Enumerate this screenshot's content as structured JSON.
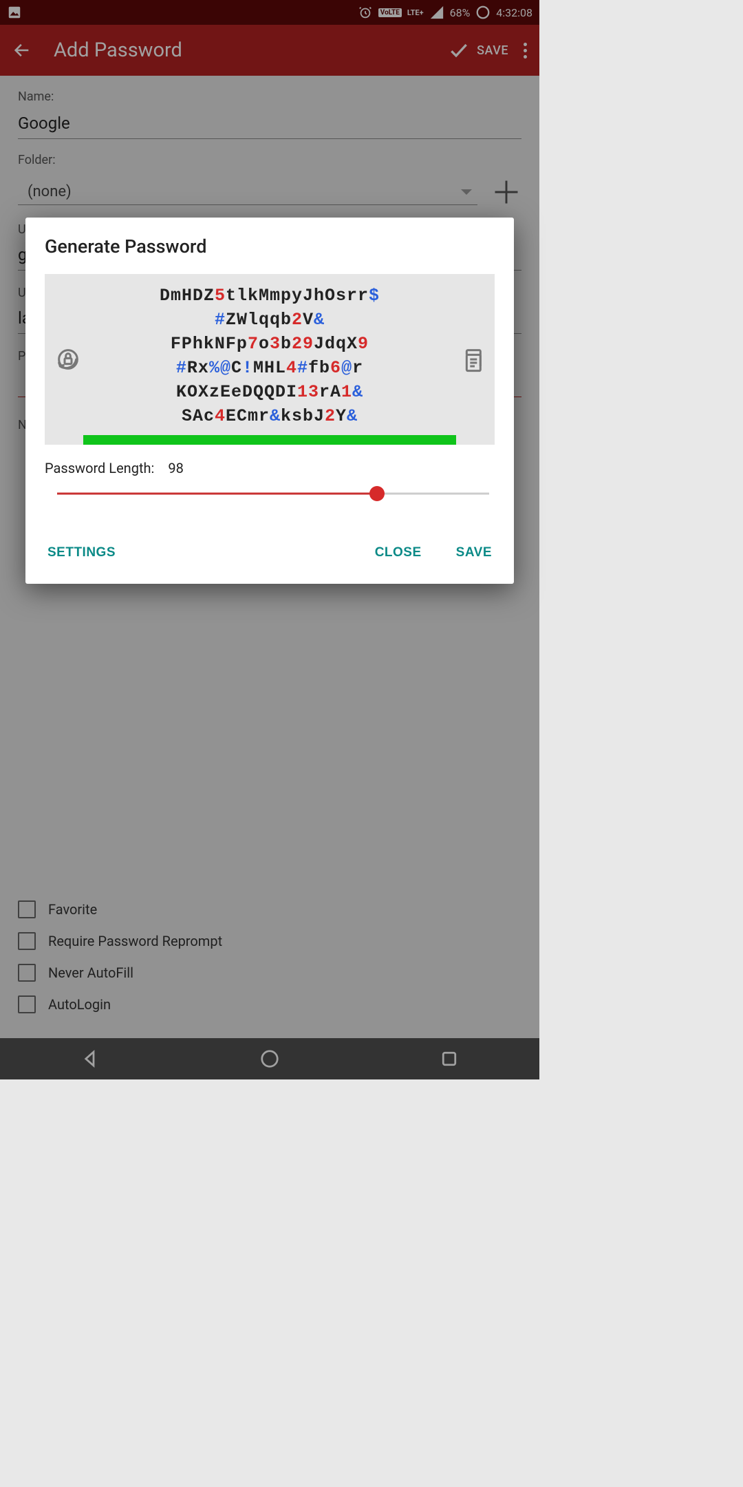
{
  "status_bar": {
    "volte_label": "VoLTE",
    "lte_label": "LTE+",
    "battery_percent": "68%",
    "time": "4:32:08"
  },
  "app_bar": {
    "title": "Add Password",
    "save_label": "SAVE"
  },
  "form": {
    "name_label": "Name:",
    "name_value": "Google",
    "folder_label": "Folder:",
    "folder_value": "(none)",
    "url_label_partial": "UR",
    "url_value_partial": "g",
    "username_label_partial": "Us",
    "username_value_partial": "la",
    "password_label_partial": "Pa",
    "notes_label_partial": "No"
  },
  "checkboxes": {
    "favorite": "Favorite",
    "reprompt": "Require Password Reprompt",
    "never_autofill": "Never AutoFill",
    "autologin": "AutoLogin"
  },
  "dialog": {
    "title": "Generate Password",
    "password_segments": [
      {
        "t": "DmHDZ",
        "c": ""
      },
      {
        "t": "5",
        "c": "red"
      },
      {
        "t": "tlkMmpyJhOsrr",
        "c": ""
      },
      {
        "t": "$",
        "c": "blue"
      },
      {
        "t": " ",
        "br": true
      },
      {
        "t": "#",
        "c": "blue"
      },
      {
        "t": "ZWlqqb",
        "c": ""
      },
      {
        "t": "2",
        "c": "red"
      },
      {
        "t": "V",
        "c": ""
      },
      {
        "t": "&",
        "c": "blue"
      },
      {
        "t": " ",
        "br": true
      },
      {
        "t": "FPhkNFp",
        "c": ""
      },
      {
        "t": "7",
        "c": "red"
      },
      {
        "t": "o",
        "c": ""
      },
      {
        "t": "3",
        "c": "red"
      },
      {
        "t": "b",
        "c": ""
      },
      {
        "t": "29",
        "c": "red"
      },
      {
        "t": "JdqX",
        "c": ""
      },
      {
        "t": "9",
        "c": "red"
      },
      {
        "t": " ",
        "br": true
      },
      {
        "t": "#",
        "c": "blue"
      },
      {
        "t": "Rx",
        "c": ""
      },
      {
        "t": "%@",
        "c": "blue"
      },
      {
        "t": "C",
        "c": ""
      },
      {
        "t": "!",
        "c": "blue"
      },
      {
        "t": "MHL",
        "c": ""
      },
      {
        "t": "4",
        "c": "red"
      },
      {
        "t": "#",
        "c": "blue"
      },
      {
        "t": "fb",
        "c": ""
      },
      {
        "t": "6",
        "c": "red"
      },
      {
        "t": "@",
        "c": "blue"
      },
      {
        "t": "r",
        "c": ""
      },
      {
        "t": " ",
        "br": true
      },
      {
        "t": "KOXzEeDQQDI",
        "c": ""
      },
      {
        "t": "13",
        "c": "red"
      },
      {
        "t": "rA",
        "c": ""
      },
      {
        "t": "1",
        "c": "red"
      },
      {
        "t": "&",
        "c": "blue"
      },
      {
        "t": " ",
        "br": true
      },
      {
        "t": "SAc",
        "c": ""
      },
      {
        "t": "4",
        "c": "red"
      },
      {
        "t": "ECmr",
        "c": ""
      },
      {
        "t": "&",
        "c": "blue"
      },
      {
        "t": "ksbJ",
        "c": ""
      },
      {
        "t": "2",
        "c": "red"
      },
      {
        "t": "Y",
        "c": ""
      },
      {
        "t": "&",
        "c": "blue"
      }
    ],
    "length_label": "Password Length:",
    "length_value": "98",
    "slider_percent": 74,
    "settings_label": "SETTINGS",
    "close_label": "CLOSE",
    "save_label": "SAVE"
  }
}
